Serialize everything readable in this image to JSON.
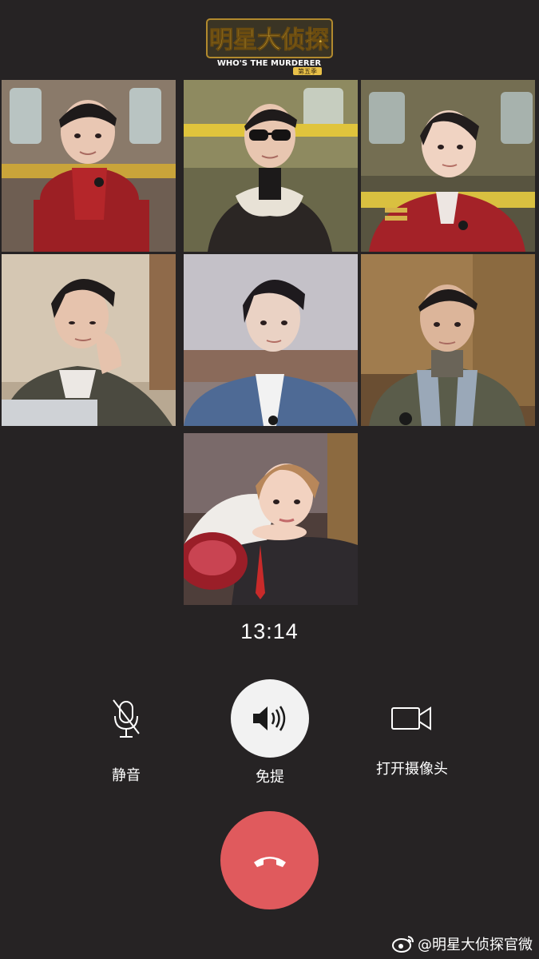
{
  "show": {
    "logo_title": "明星大侦探",
    "logo_subtitle": "WHO'S THE MURDERER",
    "logo_season": "第五季"
  },
  "participants": [
    {
      "name": "participant-1",
      "bg": "#7a5a4e",
      "coat": "#9c1f24",
      "scarf": "#b5262a"
    },
    {
      "name": "participant-2",
      "bg": "#8f8a55",
      "coat": "#2b2624",
      "scarf": "#e8e2d6"
    },
    {
      "name": "participant-3",
      "bg": "#6f6a4a",
      "coat": "#a42228",
      "scarf": "#ede6e2"
    },
    {
      "name": "participant-4",
      "bg": "#c9bba8",
      "coat": "#4b4a40",
      "scarf": "#ece8e4"
    },
    {
      "name": "participant-5",
      "bg": "#8c7d7a",
      "coat": "#4e6a95",
      "scarf": "#f2f2f2"
    },
    {
      "name": "participant-6",
      "bg": "#8a6a42",
      "coat": "#5a5c4a",
      "scarf": "#9aa8b8"
    },
    {
      "name": "participant-7",
      "bg": "#5a4a44",
      "coat": "#efece8",
      "scarf": "#2e2a2e"
    }
  ],
  "call": {
    "timer": "13:14"
  },
  "controls": {
    "mute_label": "静音",
    "speaker_label": "免提",
    "camera_label": "打开摄像头",
    "hangup_icon": "phone-hangup-icon"
  },
  "colors": {
    "background": "#262324",
    "hangup": "#e05a5d",
    "speaker_active": "#f2f2f2"
  },
  "watermark": {
    "text": "@明星大侦探官微"
  }
}
